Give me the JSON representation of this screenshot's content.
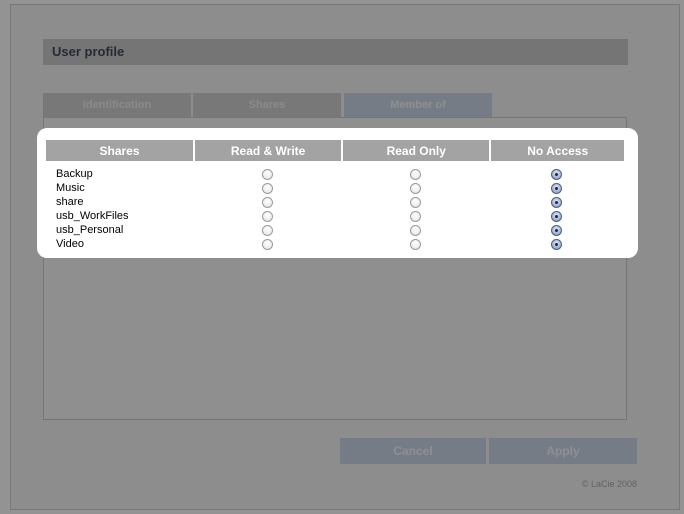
{
  "dialog": {
    "title": "User profile",
    "tabs": [
      {
        "label": "Identification",
        "active": false
      },
      {
        "label": "Shares",
        "active": false
      },
      {
        "label": "Member of",
        "active": true
      }
    ],
    "buttons": {
      "cancel": "Cancel",
      "apply": "Apply"
    },
    "copyright": "© LaCie 2008"
  },
  "shares_table": {
    "columns": [
      "Shares",
      "Read & Write",
      "Read Only",
      "No Access"
    ],
    "rows": [
      {
        "name": "Backup",
        "access": "No Access"
      },
      {
        "name": "Music",
        "access": "No Access"
      },
      {
        "name": "share",
        "access": "No Access"
      },
      {
        "name": "usb_WorkFiles",
        "access": "No Access"
      },
      {
        "name": "usb_Personal",
        "access": "No Access"
      },
      {
        "name": "Video",
        "access": "No Access"
      }
    ]
  },
  "colors": {
    "overlay": "#282828",
    "header_bg": "#a3a3a3",
    "active_tab": "#c2d1e4"
  }
}
